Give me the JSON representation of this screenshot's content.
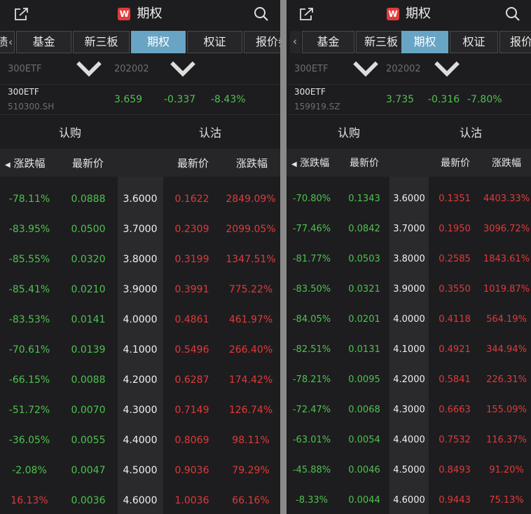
{
  "colors": {
    "green": "#4ec24e",
    "red": "#e03a3a",
    "accent": "#68a4c4",
    "brand": "#e23b3b"
  },
  "panels": [
    {
      "header": {
        "title": "期权",
        "logo": "W"
      },
      "tabs": [
        "债",
        "基金",
        "新三板",
        "期权",
        "权证",
        "报价券"
      ],
      "filters": {
        "underlying": "300ETF",
        "month": "202002"
      },
      "quote": {
        "name": "300ETF",
        "code": "510300.SH",
        "price": "3.659",
        "change": "-0.337",
        "pct": "-8.43%"
      },
      "sides": {
        "call": "认购",
        "put": "认沽"
      },
      "columns": {
        "call_pct": "涨跌幅",
        "call_price": "最新价",
        "put_price": "最新价",
        "put_pct": "涨跌幅"
      },
      "rows": [
        {
          "call_pct": "-78.11%",
          "call_price": "0.0888",
          "strike": "3.6000",
          "put_price": "0.1622",
          "put_pct": "2849.09%"
        },
        {
          "call_pct": "-83.95%",
          "call_price": "0.0500",
          "strike": "3.7000",
          "put_price": "0.2309",
          "put_pct": "2099.05%"
        },
        {
          "call_pct": "-85.55%",
          "call_price": "0.0320",
          "strike": "3.8000",
          "put_price": "0.3199",
          "put_pct": "1347.51%"
        },
        {
          "call_pct": "-85.41%",
          "call_price": "0.0210",
          "strike": "3.9000",
          "put_price": "0.3991",
          "put_pct": "775.22%"
        },
        {
          "call_pct": "-83.53%",
          "call_price": "0.0141",
          "strike": "4.0000",
          "put_price": "0.4861",
          "put_pct": "461.97%"
        },
        {
          "call_pct": "-70.61%",
          "call_price": "0.0139",
          "strike": "4.1000",
          "put_price": "0.5496",
          "put_pct": "266.40%"
        },
        {
          "call_pct": "-66.15%",
          "call_price": "0.0088",
          "strike": "4.2000",
          "put_price": "0.6287",
          "put_pct": "174.42%"
        },
        {
          "call_pct": "-51.72%",
          "call_price": "0.0070",
          "strike": "4.3000",
          "put_price": "0.7149",
          "put_pct": "126.74%"
        },
        {
          "call_pct": "-36.05%",
          "call_price": "0.0055",
          "strike": "4.4000",
          "put_price": "0.8069",
          "put_pct": "98.11%"
        },
        {
          "call_pct": "-2.08%",
          "call_price": "0.0047",
          "strike": "4.5000",
          "put_price": "0.9036",
          "put_pct": "79.29%"
        },
        {
          "call_pct": "16.13%",
          "call_price": "0.0036",
          "strike": "4.6000",
          "put_price": "1.0036",
          "put_pct": "66.16%"
        }
      ]
    },
    {
      "header": {
        "title": "期权",
        "logo": "W"
      },
      "tabs": [
        "基金",
        "新三板",
        "期权",
        "权证",
        "报价券"
      ],
      "filters": {
        "underlying": "300ETF",
        "month": "202002"
      },
      "quote": {
        "name": "300ETF",
        "code": "159919.SZ",
        "price": "3.735",
        "change": "-0.316",
        "pct": "-7.80%"
      },
      "sides": {
        "call": "认购",
        "put": "认沽"
      },
      "columns": {
        "call_pct": "涨跌幅",
        "call_price": "最新价",
        "put_price": "最新价",
        "put_pct": "涨跌幅"
      },
      "rows": [
        {
          "call_pct": "-70.80%",
          "call_price": "0.1343",
          "strike": "3.6000",
          "put_price": "0.1351",
          "put_pct": "4403.33%"
        },
        {
          "call_pct": "-77.46%",
          "call_price": "0.0842",
          "strike": "3.7000",
          "put_price": "0.1950",
          "put_pct": "3096.72%"
        },
        {
          "call_pct": "-81.77%",
          "call_price": "0.0503",
          "strike": "3.8000",
          "put_price": "0.2585",
          "put_pct": "1843.61%"
        },
        {
          "call_pct": "-83.50%",
          "call_price": "0.0321",
          "strike": "3.9000",
          "put_price": "0.3550",
          "put_pct": "1019.87%"
        },
        {
          "call_pct": "-84.05%",
          "call_price": "0.0201",
          "strike": "4.0000",
          "put_price": "0.4118",
          "put_pct": "564.19%"
        },
        {
          "call_pct": "-82.51%",
          "call_price": "0.0131",
          "strike": "4.1000",
          "put_price": "0.4921",
          "put_pct": "344.94%"
        },
        {
          "call_pct": "-78.21%",
          "call_price": "0.0095",
          "strike": "4.2000",
          "put_price": "0.5841",
          "put_pct": "226.31%"
        },
        {
          "call_pct": "-72.47%",
          "call_price": "0.0068",
          "strike": "4.3000",
          "put_price": "0.6663",
          "put_pct": "155.09%"
        },
        {
          "call_pct": "-63.01%",
          "call_price": "0.0054",
          "strike": "4.4000",
          "put_price": "0.7532",
          "put_pct": "116.37%"
        },
        {
          "call_pct": "-45.88%",
          "call_price": "0.0046",
          "strike": "4.5000",
          "put_price": "0.8493",
          "put_pct": "91.20%"
        },
        {
          "call_pct": "-8.33%",
          "call_price": "0.0044",
          "strike": "4.6000",
          "put_price": "0.9443",
          "put_pct": "75.13%"
        }
      ]
    }
  ]
}
